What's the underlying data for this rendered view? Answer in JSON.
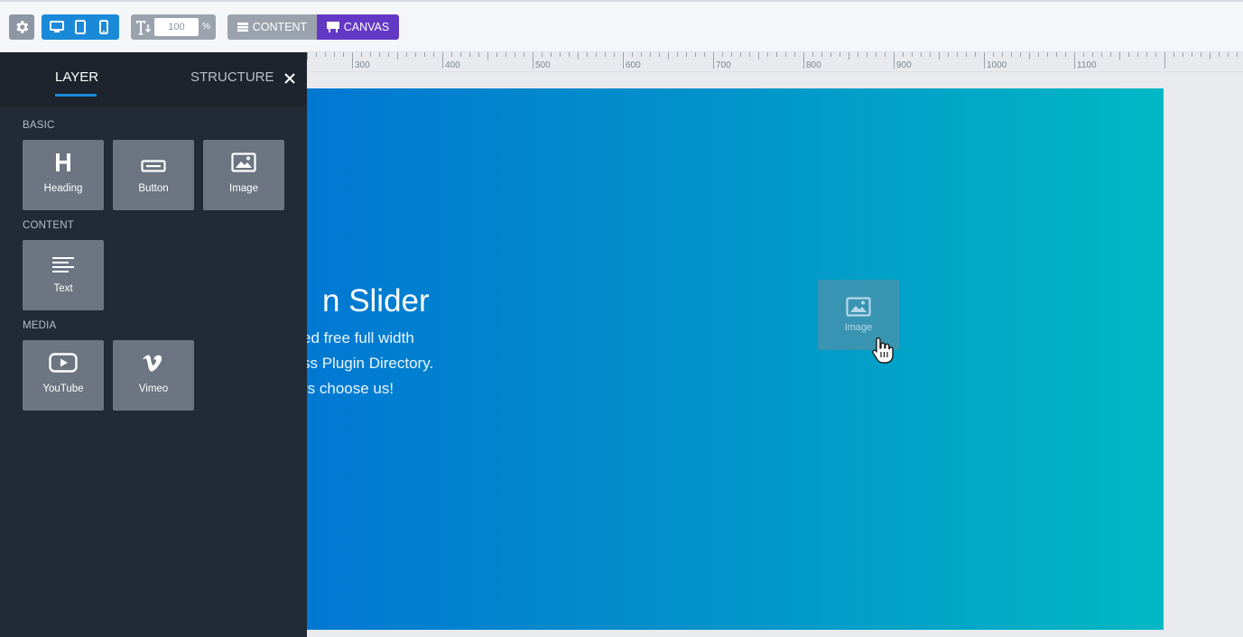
{
  "toolbar": {
    "settings_icon": "gear-icon",
    "devices": [
      "desktop-icon",
      "tablet-icon",
      "mobile-icon"
    ],
    "zoom": {
      "value": "100",
      "unit": "%"
    },
    "modes": {
      "content_label": "CONTENT",
      "canvas_label": "CANVAS",
      "active": "canvas"
    },
    "colors": {
      "device_active": "#1a8ad8",
      "canvas_active": "#6338c5"
    }
  },
  "ruler": {
    "ticks": [
      "300",
      "400",
      "500",
      "600",
      "700",
      "800",
      "900",
      "1000",
      "1100"
    ]
  },
  "panel": {
    "tabs": [
      {
        "label": "LAYER",
        "active": true
      },
      {
        "label": "STRUCTURE",
        "active": false
      }
    ],
    "sections": [
      {
        "title": "BASIC",
        "items": [
          {
            "label": "Heading",
            "icon": "heading-icon"
          },
          {
            "label": "Button",
            "icon": "button-icon"
          },
          {
            "label": "Image",
            "icon": "image-icon"
          }
        ]
      },
      {
        "title": "CONTENT",
        "items": [
          {
            "label": "Text",
            "icon": "text-icon"
          }
        ]
      },
      {
        "title": "MEDIA",
        "items": [
          {
            "label": "YouTube",
            "icon": "youtube-icon"
          },
          {
            "label": "Vimeo",
            "icon": "vimeo-icon"
          }
        ]
      }
    ]
  },
  "slide": {
    "title": "n Slider",
    "lines": [
      "ed free full width",
      "ss Plugin Directory.",
      "rs choose us!"
    ],
    "dragged_layer_label": "Image",
    "gradient": [
      "#0078d2",
      "#00b8c4"
    ]
  }
}
